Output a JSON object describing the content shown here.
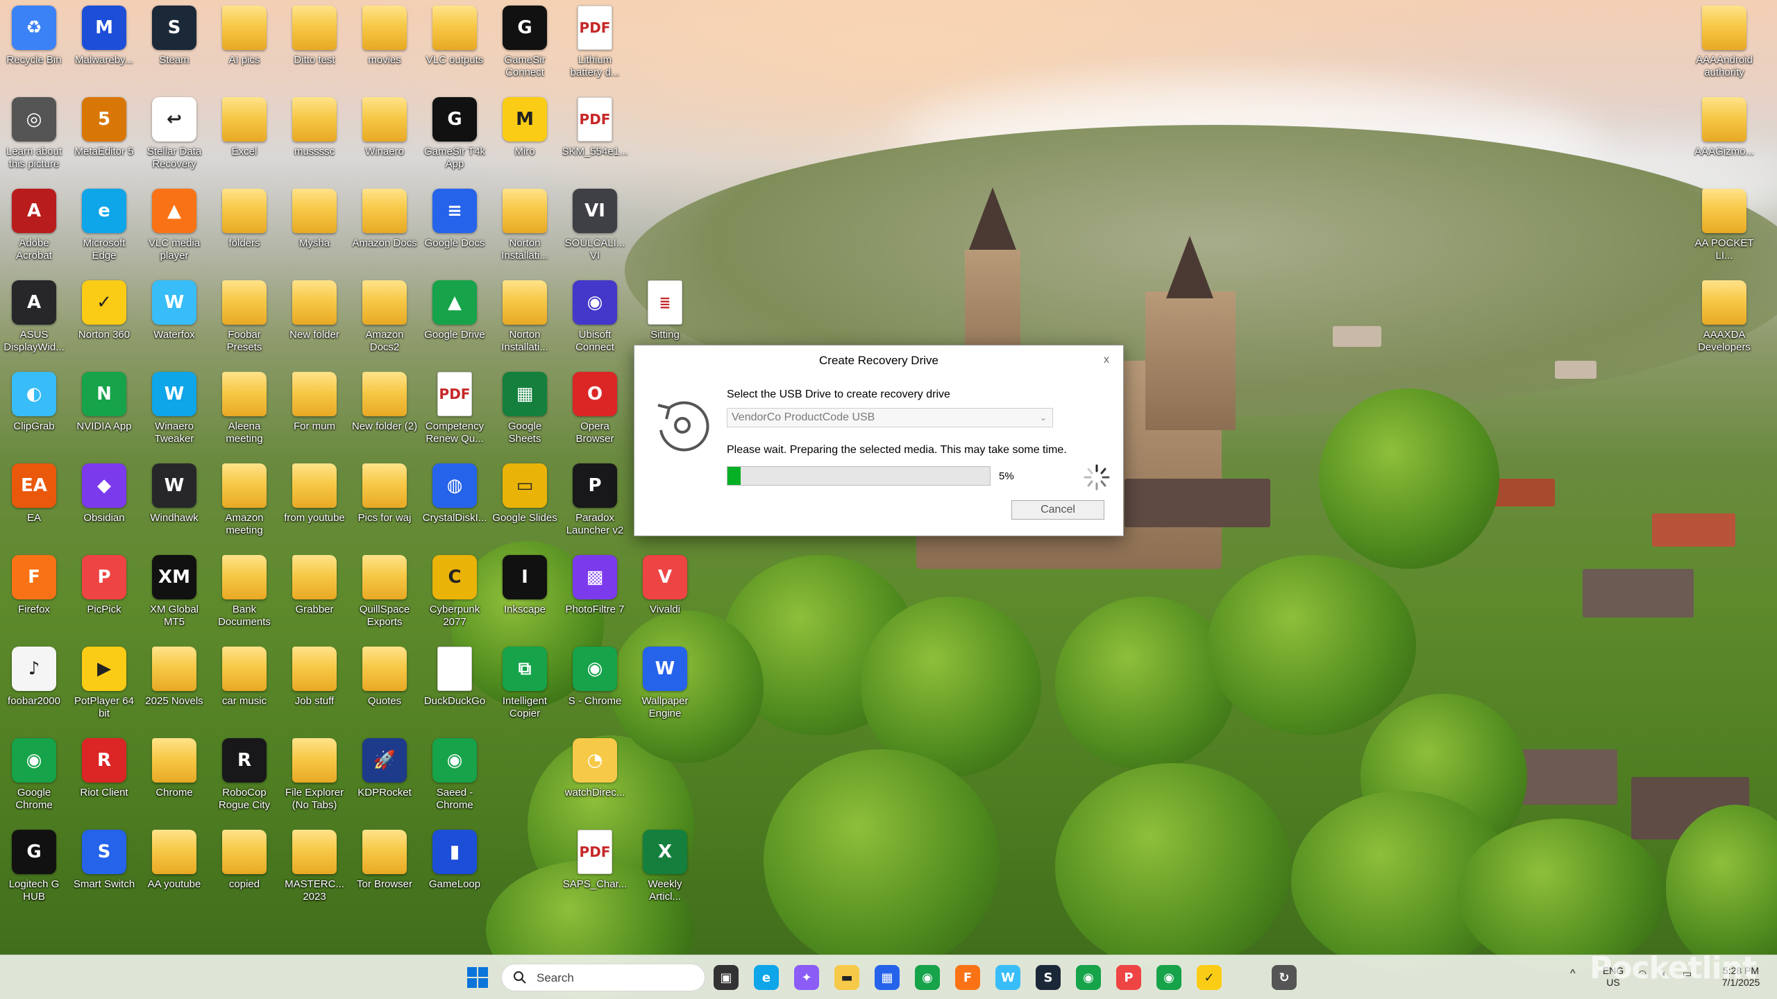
{
  "desktop": {
    "icons": [
      {
        "label": "Recycle Bin",
        "icon": "recycle-bin-icon",
        "color": "#3b82f6",
        "glyph": "♻"
      },
      {
        "label": "Malwareby...",
        "icon": "malwarebytes-icon",
        "color": "#1d4ed8",
        "glyph": "M"
      },
      {
        "label": "Steam",
        "icon": "steam-icon",
        "color": "#1b2838",
        "glyph": "S"
      },
      {
        "label": "AI pics",
        "icon": "folder-icon",
        "color": "#f7c948",
        "glyph": ""
      },
      {
        "label": "Ditto test",
        "icon": "folder-icon",
        "color": "#f7c948",
        "glyph": ""
      },
      {
        "label": "movies",
        "icon": "folder-icon",
        "color": "#f7c948",
        "glyph": ""
      },
      {
        "label": "VLC outputs",
        "icon": "folder-icon",
        "color": "#f7c948",
        "glyph": ""
      },
      {
        "label": "GameSir Connect",
        "icon": "gamesir-icon",
        "color": "#111111",
        "glyph": "G"
      },
      {
        "label": "Lithium battery d...",
        "icon": "pdf-icon",
        "color": "#ffffff",
        "glyph": "PDF"
      },
      {
        "label": "Learn about this picture",
        "icon": "learn-about-picture-icon",
        "color": "#555555",
        "glyph": "◎"
      },
      {
        "label": "MetaEditor 5",
        "icon": "metaeditor-icon",
        "color": "#d97706",
        "glyph": "5"
      },
      {
        "label": "Stellar Data Recovery",
        "icon": "stellar-data-recovery-icon",
        "color": "#ffffff",
        "glyph": "↩"
      },
      {
        "label": "Excel",
        "icon": "folder-icon",
        "color": "#f7c948",
        "glyph": ""
      },
      {
        "label": "mussssc",
        "icon": "folder-icon",
        "color": "#f7c948",
        "glyph": ""
      },
      {
        "label": "Winaero",
        "icon": "folder-icon",
        "color": "#f7c948",
        "glyph": ""
      },
      {
        "label": "GameSir T4k App",
        "icon": "gamesir-icon",
        "color": "#111111",
        "glyph": "G"
      },
      {
        "label": "Miro",
        "icon": "miro-icon",
        "color": "#facc15",
        "glyph": "M"
      },
      {
        "label": "SKM_554e1...",
        "icon": "pdf-icon",
        "color": "#ffffff",
        "glyph": "PDF"
      },
      {
        "label": "Adobe Acrobat",
        "icon": "adobe-acrobat-icon",
        "color": "#b91c1c",
        "glyph": "A"
      },
      {
        "label": "Microsoft Edge",
        "icon": "edge-icon",
        "color": "#0ea5e9",
        "glyph": "e"
      },
      {
        "label": "VLC media player",
        "icon": "vlc-icon",
        "color": "#f97316",
        "glyph": "▲"
      },
      {
        "label": "folders",
        "icon": "folder-icon",
        "color": "#f7c948",
        "glyph": ""
      },
      {
        "label": "Mysha",
        "icon": "folder-icon",
        "color": "#f7c948",
        "glyph": ""
      },
      {
        "label": "Amazon Docs",
        "icon": "folder-icon",
        "color": "#f7c948",
        "glyph": ""
      },
      {
        "label": "Google Docs",
        "icon": "google-docs-icon",
        "color": "#2563eb",
        "glyph": "≡"
      },
      {
        "label": "Norton Installati...",
        "icon": "folder-icon",
        "color": "#f7c948",
        "glyph": ""
      },
      {
        "label": "SOULCALI... VI",
        "icon": "soulcalibur-icon",
        "color": "#3f3f46",
        "glyph": "VI"
      },
      {
        "label": "ASUS DisplayWid...",
        "icon": "asus-icon",
        "color": "#27272a",
        "glyph": "A"
      },
      {
        "label": "Norton 360",
        "icon": "norton-icon",
        "color": "#facc15",
        "glyph": "✓"
      },
      {
        "label": "Waterfox",
        "icon": "waterfox-icon",
        "color": "#38bdf8",
        "glyph": "W"
      },
      {
        "label": "Foobar Presets",
        "icon": "folder-icon",
        "color": "#f7c948",
        "glyph": ""
      },
      {
        "label": "New folder",
        "icon": "folder-icon",
        "color": "#f7c948",
        "glyph": ""
      },
      {
        "label": "Amazon Docs2",
        "icon": "folder-icon",
        "color": "#f7c948",
        "glyph": ""
      },
      {
        "label": "Google Drive",
        "icon": "google-drive-icon",
        "color": "#16a34a",
        "glyph": "▲"
      },
      {
        "label": "Norton Installati...",
        "icon": "folder-icon",
        "color": "#f7c948",
        "glyph": ""
      },
      {
        "label": "Ubisoft Connect",
        "icon": "ubisoft-icon",
        "color": "#4338ca",
        "glyph": "◉"
      },
      {
        "label": "Sitting",
        "icon": "document-icon",
        "color": "#ffffff",
        "glyph": "≣"
      },
      {
        "label": "ClipGrab",
        "icon": "clipgrab-icon",
        "color": "#38bdf8",
        "glyph": "◐"
      },
      {
        "label": "NVIDIA App",
        "icon": "nvidia-icon",
        "color": "#16a34a",
        "glyph": "N"
      },
      {
        "label": "Winaero Tweaker",
        "icon": "winaero-tweaker-icon",
        "color": "#0ea5e9",
        "glyph": "W"
      },
      {
        "label": "Aleena meeting",
        "icon": "folder-icon",
        "color": "#f7c948",
        "glyph": ""
      },
      {
        "label": "For mum",
        "icon": "folder-icon",
        "color": "#f7c948",
        "glyph": ""
      },
      {
        "label": "New folder (2)",
        "icon": "folder-icon",
        "color": "#f7c948",
        "glyph": ""
      },
      {
        "label": "Competency Renew Qu...",
        "icon": "pdf-icon",
        "color": "#ffffff",
        "glyph": "PDF"
      },
      {
        "label": "Google Sheets",
        "icon": "google-sheets-icon",
        "color": "#15803d",
        "glyph": "▦"
      },
      {
        "label": "Opera Browser",
        "icon": "opera-icon",
        "color": "#dc2626",
        "glyph": "O"
      },
      {
        "label": "EA",
        "icon": "ea-icon",
        "color": "#ea580c",
        "glyph": "EA"
      },
      {
        "label": "Obsidian",
        "icon": "obsidian-icon",
        "color": "#7c3aed",
        "glyph": "◆"
      },
      {
        "label": "Windhawk",
        "icon": "windhawk-icon",
        "color": "#27272a",
        "glyph": "W"
      },
      {
        "label": "Amazon meeting",
        "icon": "folder-icon",
        "color": "#f7c948",
        "glyph": ""
      },
      {
        "label": "from youtube",
        "icon": "folder-icon",
        "color": "#f7c948",
        "glyph": ""
      },
      {
        "label": "Pics for waj",
        "icon": "folder-icon",
        "color": "#f7c948",
        "glyph": ""
      },
      {
        "label": "CrystalDiskI...",
        "icon": "crystaldiskinfo-icon",
        "color": "#2563eb",
        "glyph": "◍"
      },
      {
        "label": "Google Slides",
        "icon": "google-slides-icon",
        "color": "#eab308",
        "glyph": "▭"
      },
      {
        "label": "Paradox Launcher v2",
        "icon": "paradox-icon",
        "color": "#18181b",
        "glyph": "P"
      },
      {
        "label": "Firefox",
        "icon": "firefox-icon",
        "color": "#f97316",
        "glyph": "F"
      },
      {
        "label": "PicPick",
        "icon": "picpick-icon",
        "color": "#ef4444",
        "glyph": "P"
      },
      {
        "label": "XM Global MT5",
        "icon": "xm-icon",
        "color": "#111111",
        "glyph": "XM"
      },
      {
        "label": "Bank Documents",
        "icon": "folder-icon",
        "color": "#f7c948",
        "glyph": ""
      },
      {
        "label": "Grabber",
        "icon": "folder-icon",
        "color": "#f7c948",
        "glyph": ""
      },
      {
        "label": "QuillSpace Exports",
        "icon": "folder-icon",
        "color": "#f7c948",
        "glyph": ""
      },
      {
        "label": "Cyberpunk 2077",
        "icon": "cyberpunk-icon",
        "color": "#eab308",
        "glyph": "C"
      },
      {
        "label": "Inkscape",
        "icon": "inkscape-icon",
        "color": "#111111",
        "glyph": "I"
      },
      {
        "label": "PhotoFiltre 7",
        "icon": "photofiltre-icon",
        "color": "#7c3aed",
        "glyph": "▩"
      },
      {
        "label": "Vivaldi",
        "icon": "vivaldi-icon",
        "color": "#ef4444",
        "glyph": "V"
      },
      {
        "label": "foobar2000",
        "icon": "foobar2000-icon",
        "color": "#f5f5f5",
        "glyph": "♪"
      },
      {
        "label": "PotPlayer 64 bit",
        "icon": "potplayer-icon",
        "color": "#facc15",
        "glyph": "▶"
      },
      {
        "label": "2025 Novels",
        "icon": "folder-icon",
        "color": "#f7c948",
        "glyph": ""
      },
      {
        "label": "car music",
        "icon": "folder-icon",
        "color": "#f7c948",
        "glyph": ""
      },
      {
        "label": "Job stuff",
        "icon": "folder-icon",
        "color": "#f7c948",
        "glyph": ""
      },
      {
        "label": "Quotes",
        "icon": "folder-icon",
        "color": "#f7c948",
        "glyph": ""
      },
      {
        "label": "DuckDuckGo",
        "icon": "document-icon",
        "color": "#ffffff",
        "glyph": ""
      },
      {
        "label": "Intelligent Copier",
        "icon": "intelligent-copier-icon",
        "color": "#16a34a",
        "glyph": "⧉"
      },
      {
        "label": "S - Chrome",
        "icon": "chrome-icon",
        "color": "#16a34a",
        "glyph": "◉"
      },
      {
        "label": "Wallpaper Engine",
        "icon": "wallpaper-engine-icon",
        "color": "#2563eb",
        "glyph": "W"
      },
      {
        "label": "Google Chrome",
        "icon": "chrome-icon",
        "color": "#16a34a",
        "glyph": "◉"
      },
      {
        "label": "Riot Client",
        "icon": "riot-client-icon",
        "color": "#dc2626",
        "glyph": "R"
      },
      {
        "label": "Chrome",
        "icon": "folder-icon",
        "color": "#f7c948",
        "glyph": ""
      },
      {
        "label": "RoboCop Rogue City",
        "icon": "robocop-icon",
        "color": "#18181b",
        "glyph": "R"
      },
      {
        "label": "File Explorer (No Tabs)",
        "icon": "folder-icon",
        "color": "#f7c948",
        "glyph": ""
      },
      {
        "label": "KDPRocket",
        "icon": "kdprocket-icon",
        "color": "#1e3a8a",
        "glyph": "🚀"
      },
      {
        "label": "Saeed - Chrome",
        "icon": "chrome-icon",
        "color": "#16a34a",
        "glyph": "◉"
      },
      {
        "label": "watchDirec...",
        "icon": "watchdirectory-icon",
        "color": "#f7c948",
        "glyph": "◔"
      },
      {
        "label": "Logitech G HUB",
        "icon": "logitech-icon",
        "color": "#111111",
        "glyph": "G"
      },
      {
        "label": "Smart Switch",
        "icon": "smart-switch-icon",
        "color": "#2563eb",
        "glyph": "S"
      },
      {
        "label": "AA youtube",
        "icon": "folder-icon",
        "color": "#f7c948",
        "glyph": ""
      },
      {
        "label": "copied",
        "icon": "folder-icon",
        "color": "#f7c948",
        "glyph": ""
      },
      {
        "label": "MASTERC... 2023",
        "icon": "folder-icon",
        "color": "#f7c948",
        "glyph": ""
      },
      {
        "label": "Tor Browser",
        "icon": "folder-icon",
        "color": "#f7c948",
        "glyph": ""
      },
      {
        "label": "GameLoop",
        "icon": "gameloop-icon",
        "color": "#1d4ed8",
        "glyph": "▮"
      },
      {
        "label": "SAPS_Char...",
        "icon": "pdf-icon",
        "color": "#ffffff",
        "glyph": "PDF"
      },
      {
        "label": "Weekly Articl...",
        "icon": "excel-icon",
        "color": "#15803d",
        "glyph": "X"
      },
      {
        "label": "AAAAndroid authority",
        "icon": "folder-icon",
        "color": "#f7c948",
        "glyph": ""
      },
      {
        "label": "AAAGizmo...",
        "icon": "folder-icon",
        "color": "#f7c948",
        "glyph": ""
      },
      {
        "label": "AA POCKET LI...",
        "icon": "folder-icon",
        "color": "#f7c948",
        "glyph": ""
      },
      {
        "label": "AAAXDA Developers",
        "icon": "folder-icon",
        "color": "#f7c948",
        "glyph": ""
      }
    ]
  },
  "dialog": {
    "title": "Create Recovery Drive",
    "close_label": "x",
    "prompt": "Select the USB Drive to create recovery drive",
    "usb_selected": "VendorCo ProductCode USB",
    "wait_message": "Please wait. Preparing the selected media. This may take some time.",
    "progress_percent": 5,
    "progress_label": "5%",
    "cancel_label": "Cancel"
  },
  "taskbar": {
    "search_placeholder": "Search",
    "apps": [
      {
        "name": "task-view-icon",
        "color": "#333333",
        "glyph": "▣"
      },
      {
        "name": "edge-icon",
        "color": "#0ea5e9",
        "glyph": "e"
      },
      {
        "name": "copilot-icon",
        "color": "#8b5cf6",
        "glyph": "✦"
      },
      {
        "name": "file-explorer-icon",
        "color": "#f7c948",
        "glyph": "▬"
      },
      {
        "name": "microsoft-store-icon",
        "color": "#2563eb",
        "glyph": "▦"
      },
      {
        "name": "chrome-icon",
        "color": "#16a34a",
        "glyph": "◉"
      },
      {
        "name": "firefox-icon",
        "color": "#f97316",
        "glyph": "F"
      },
      {
        "name": "waterfox-icon",
        "color": "#38bdf8",
        "glyph": "W"
      },
      {
        "name": "steam-icon",
        "color": "#1b2838",
        "glyph": "S"
      },
      {
        "name": "chrome-profile-icon",
        "color": "#16a34a",
        "glyph": "◉"
      },
      {
        "name": "picpick-icon",
        "color": "#ef4444",
        "glyph": "P"
      },
      {
        "name": "chrome-profile-s-icon",
        "color": "#16a34a",
        "glyph": "◉"
      },
      {
        "name": "norton-icon",
        "color": "#facc15",
        "glyph": "✓"
      },
      {
        "name": "recovery-drive-icon",
        "color": "#555555",
        "glyph": "↻"
      }
    ],
    "tray": {
      "language_top": "ENG",
      "language_bottom": "US",
      "time": "5:28 PM",
      "date": "7/1/2025"
    }
  },
  "watermark": "Pocketlint",
  "colors": {
    "progress_fill": "#06b025",
    "dialog_bg": "#ffffff"
  }
}
